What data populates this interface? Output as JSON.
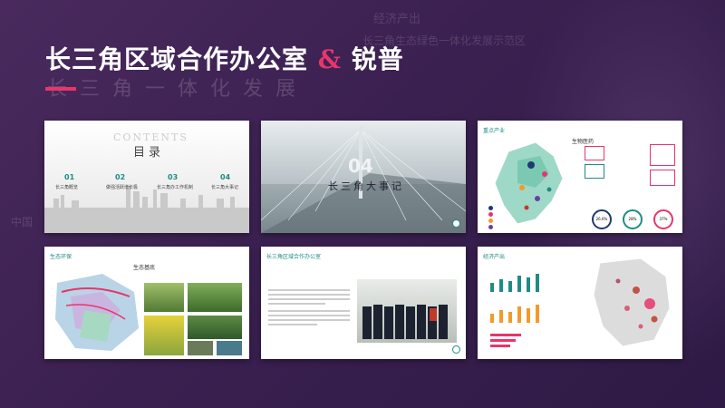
{
  "header": {
    "title_main": "长三角区域合作办公室",
    "title_amp": "&",
    "title_brand": "锐普",
    "subtitle": "长三角一体化发展"
  },
  "background_text": {
    "t1": "经济产出",
    "t2": "长三角生态绿色一体化发展示范区",
    "t3": "中国"
  },
  "slides": {
    "s1": {
      "contents": "CONTENTS",
      "heading": "目录",
      "items": [
        {
          "num": "01",
          "label": "长三角概览"
        },
        {
          "num": "02",
          "label": "做强活跃增长极"
        },
        {
          "num": "03",
          "label": "长三角办工作机制"
        },
        {
          "num": "04",
          "label": "长三角大事记"
        }
      ]
    },
    "s2": {
      "num": "04",
      "label": "长三角大事记"
    },
    "s3": {
      "heading": "重点产业",
      "sub": "生物医药",
      "stats": [
        "26.6%",
        "28%",
        "37%"
      ]
    },
    "s4": {
      "heading": "生态环保",
      "sub": "生态基底"
    },
    "s5": {
      "heading": "长三角区域合作办公室"
    },
    "s6": {
      "heading": "经济产出"
    }
  },
  "colors": {
    "accent": "#e8356c",
    "teal": "#1e8c84",
    "bg": "#3a2050"
  }
}
